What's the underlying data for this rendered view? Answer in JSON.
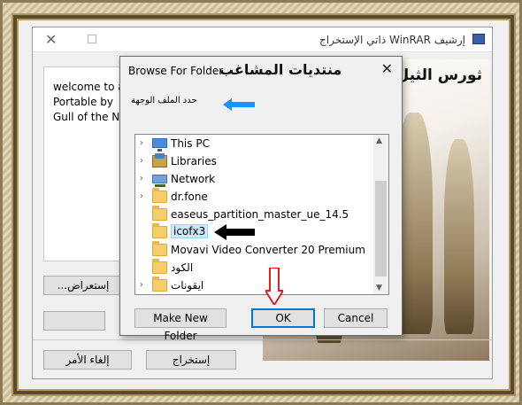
{
  "sfx": {
    "title": "إرشيف WinRAR ذاتي الإستخراج",
    "welcome_lines": [
      "welcome to ab",
      "Portable by",
      "Gull of the Nile"
    ],
    "banner_title": "ثورس الثيل",
    "browse_button": "إستعراض...",
    "cancel_button": "إلغاء الأمر",
    "extract_button": "إستخراج"
  },
  "dialog": {
    "title": "Browse For Folder",
    "forum_overlay": "منتديات المشاغب",
    "instruction": "حدد الملف الوجهة",
    "tree": [
      {
        "label": "This PC",
        "icon": "computer-icon"
      },
      {
        "label": "Libraries",
        "icon": "libraries-icon"
      },
      {
        "label": "Network",
        "icon": "network-icon"
      },
      {
        "label": "dr.fone",
        "icon": "folder-icon"
      },
      {
        "label": "easeus_partition_master_ue_14.5",
        "icon": "folder-icon"
      },
      {
        "label": "icofx3",
        "icon": "folder-icon",
        "selected": true
      },
      {
        "label": "Movavi Video Converter 20 Premium",
        "icon": "folder-icon"
      },
      {
        "label": "الكود",
        "icon": "folder-icon"
      },
      {
        "label": "ايقونات",
        "icon": "folder-icon"
      }
    ],
    "make_new_folder": "Make New Folder",
    "ok": "OK",
    "cancel": "Cancel"
  },
  "colors": {
    "selection": "#cce8ff",
    "accent": "#0078d7",
    "annotation_blue": "#1e90ff",
    "annotation_red": "#e02020"
  }
}
